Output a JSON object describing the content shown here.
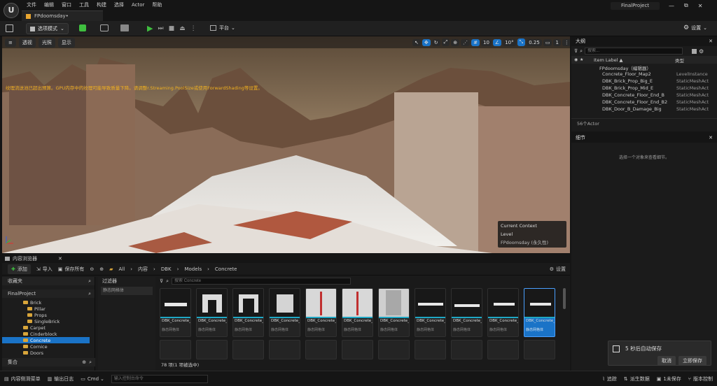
{
  "menu": [
    "文件",
    "编辑",
    "窗口",
    "工具",
    "构建",
    "选择",
    "Actor",
    "帮助"
  ],
  "logo": "U",
  "doc_tab": "FPdoomsday•",
  "project_name": "FinalProject",
  "window_buttons": [
    "—",
    "⧉",
    "✕"
  ],
  "toolbar": {
    "save_icon": "save-icon",
    "mode": "选项模式",
    "platform": "平台",
    "settings": "设置"
  },
  "viewport": {
    "perspective": "透视",
    "lighting": "光照",
    "show": "显示",
    "grid_value": "10",
    "angle_value": "10°",
    "scale_value": "0.25",
    "camera_speed": "1",
    "warning_text": "纹理流送池已超出预算。GPU内存中的纹理可能导致质量下降。请调整r.Streaming.PoolSize或使用ForwardShading等设置。",
    "context_title": "Current Context",
    "context_level_label": "Level",
    "context_level_value": "FPdoomsday (永久性)"
  },
  "outliner": {
    "title": "大纲",
    "search_placeholder": "搜索...",
    "col_label": "Item Label ▲",
    "col_type": "类型",
    "rows": [
      {
        "label": "FPdoomsday（编辑器）",
        "type": ""
      },
      {
        "label": "Concrete_Floor_Map2",
        "type": "LevelInstance"
      },
      {
        "label": "DBK_Brick_Prop_Big_E",
        "type": "StaticMeshAct"
      },
      {
        "label": "DBK_Brick_Prop_Mid_E",
        "type": "StaticMeshAct"
      },
      {
        "label": "DBK_Concrete_Floor_End_B",
        "type": "StaticMeshAct"
      },
      {
        "label": "DBK_Concrete_Floor_End_B2",
        "type": "StaticMeshAct"
      },
      {
        "label": "DBK_Door_B_Damage_Big",
        "type": "StaticMeshAct"
      }
    ],
    "count": "56个Actor"
  },
  "details": {
    "title": "细节",
    "empty_text": "选择一个对象来查看细节。"
  },
  "content_browser": {
    "tab": "内容浏览器",
    "add": "添加",
    "import": "导入",
    "save_all": "保存所有",
    "breadcrumb": [
      "All",
      "内容",
      "DBK",
      "Models",
      "Concrete"
    ],
    "settings": "设置",
    "favorites": "收藏夹",
    "project": "FinalProject",
    "filters": "过滤器",
    "filter_placeholder": "静态网格体",
    "search_placeholder": "搜索 Concrete",
    "collections": "集合",
    "tree": [
      "Brick",
      "Pillar",
      "Props",
      "SingleBrick",
      "Carpet",
      "Cinderblock",
      "Concrete",
      "Cornice",
      "Doors"
    ],
    "assets": [
      {
        "name": "DBK_Concrete_Floor_Full",
        "sub": "静态网格体"
      },
      {
        "name": "DBK_Concrete_Wall_Door",
        "sub": "静态网格体"
      },
      {
        "name": "DBK_Concrete_Wall_Door...",
        "sub": "静态网格体"
      },
      {
        "name": "DBK_Concrete_Wall_Full",
        "sub": "静态网格体"
      },
      {
        "name": "DBK_Concrete_Corner",
        "sub": "静态网格体"
      },
      {
        "name": "DBK_Concrete_Corner_Toe",
        "sub": "静态网格体"
      },
      {
        "name": "DBK_Concrete_Corner_Top",
        "sub": "静态网格体"
      },
      {
        "name": "DBK_Concrete_Floor_90_A",
        "sub": "静态网格体"
      },
      {
        "name": "DBK_Concrete_Floor_90_B",
        "sub": "静态网格体"
      },
      {
        "name": "DBK_Concrete_Floor_End_A",
        "sub": "静态网格体"
      },
      {
        "name": "DBK_Concrete_Floor_End_B",
        "sub": "静态网格体"
      }
    ],
    "item_count": "78 项(1 项被选中)"
  },
  "status": {
    "drawer": "内容侧滑菜单",
    "log": "输出日志",
    "cmd": "Cmd",
    "cmd_placeholder": "输入控制台命令",
    "trace": "追踪",
    "derived": "派生数据",
    "unsaved": "1未保存",
    "source_control": "版本控制"
  },
  "toast": {
    "text": "5 秒后自动保存",
    "cancel": "取消",
    "save_now": "立即保存"
  },
  "colors": {
    "accent": "#1fa7c4",
    "play": "#3fbf3f",
    "folder": "#d8a53a",
    "selected": "#1a73c7"
  }
}
